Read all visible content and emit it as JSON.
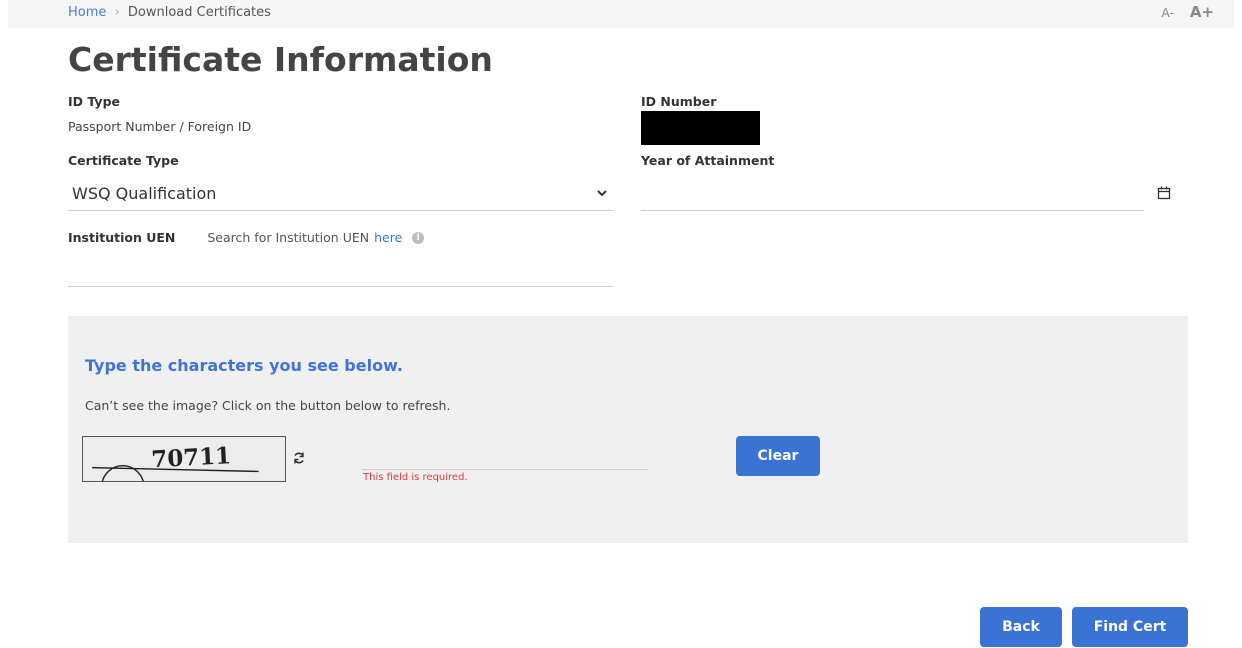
{
  "breadcrumb": {
    "home": "Home",
    "separator": "›",
    "current": "Download Certificates"
  },
  "font_controls": {
    "decrease": "A-",
    "increase": "A+"
  },
  "page_title": "Certificate Information",
  "id_type": {
    "label": "ID Type",
    "value": "Passport Number / Foreign ID"
  },
  "id_number": {
    "label": "ID Number"
  },
  "certificate_type": {
    "label": "Certificate Type",
    "selected": "WSQ Qualification"
  },
  "year_of_attainment": {
    "label": "Year of Attainment",
    "value": ""
  },
  "institution_uen": {
    "label": "Institution UEN",
    "search_text": "Search for Institution UEN",
    "link_text": "here",
    "info_glyph": "i",
    "value": ""
  },
  "captcha": {
    "heading": "Type the characters you see below.",
    "hint": "Can’t see the image? Click on the button below to refresh.",
    "image_text": "70711",
    "error": "This field is required.",
    "clear_label": "Clear"
  },
  "actions": {
    "back_label": "Back",
    "find_label": "Find Cert"
  },
  "colors": {
    "accent": "#3a73d4",
    "link": "#3f74d6",
    "error": "#e53935",
    "panel": "#f0f0f0"
  }
}
